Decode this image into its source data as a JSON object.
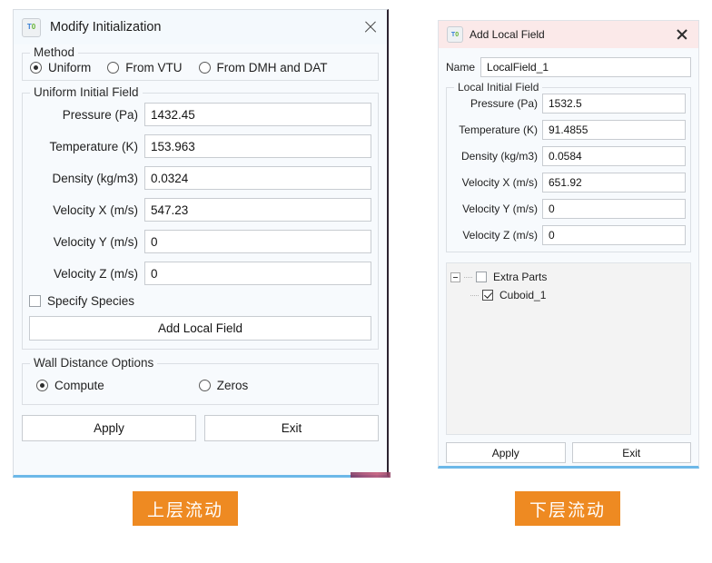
{
  "left_dialog": {
    "title": "Modify Initialization",
    "icon": "app-t0-icon",
    "close_icon": "close-icon",
    "method_group": {
      "legend": "Method",
      "options": [
        {
          "label": "Uniform",
          "selected": true
        },
        {
          "label": "From VTU",
          "selected": false
        },
        {
          "label": "From DMH and DAT",
          "selected": false
        }
      ]
    },
    "uniform_group": {
      "legend": "Uniform Initial Field",
      "fields": [
        {
          "label": "Pressure (Pa)",
          "value": "1432.45"
        },
        {
          "label": "Temperature (K)",
          "value": "153.963"
        },
        {
          "label": "Density (kg/m3)",
          "value": "0.0324"
        },
        {
          "label": "Velocity X (m/s)",
          "value": "547.23"
        },
        {
          "label": "Velocity Y (m/s)",
          "value": "0"
        },
        {
          "label": "Velocity Z (m/s)",
          "value": "0"
        }
      ],
      "specify_species": {
        "label": "Specify Species",
        "checked": false
      },
      "add_local_field_button": "Add Local Field"
    },
    "wall_distance_group": {
      "legend": "Wall Distance Options",
      "options": [
        {
          "label": "Compute",
          "selected": true
        },
        {
          "label": "Zeros",
          "selected": false
        }
      ]
    },
    "buttons": {
      "apply": "Apply",
      "exit": "Exit"
    }
  },
  "right_dialog": {
    "title": "Add Local Field",
    "icon": "app-t0-icon",
    "close_icon": "close-icon",
    "name_label": "Name",
    "name_value": "LocalField_1",
    "local_group": {
      "legend": "Local Initial Field",
      "fields": [
        {
          "label": "Pressure (Pa)",
          "value": "1532.5"
        },
        {
          "label": "Temperature (K)",
          "value": "91.4855"
        },
        {
          "label": "Density (kg/m3)",
          "value": "0.0584"
        },
        {
          "label": "Velocity X (m/s)",
          "value": "651.92"
        },
        {
          "label": "Velocity Y (m/s)",
          "value": "0"
        },
        {
          "label": "Velocity Z (m/s)",
          "value": "0"
        }
      ]
    },
    "tree": {
      "root": {
        "label": "Extra Parts",
        "checked": false,
        "expanded": true
      },
      "children": [
        {
          "label": "Cuboid_1",
          "checked": true
        }
      ]
    },
    "buttons": {
      "apply": "Apply",
      "exit": "Exit"
    }
  },
  "captions": {
    "upper": "上层流动",
    "lower": "下层流动",
    "color": "#ee8a22"
  }
}
